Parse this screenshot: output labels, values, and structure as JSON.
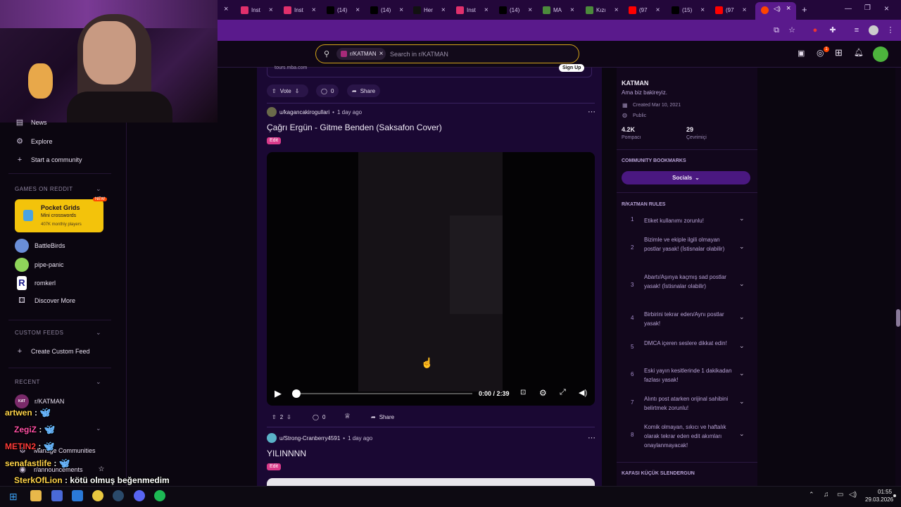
{
  "browser": {
    "tabs": [
      {
        "label": "Inst",
        "icon": "instagram-icon",
        "color": "#e1306c"
      },
      {
        "label": "Inst",
        "icon": "instagram-icon",
        "color": "#e1306c"
      },
      {
        "label": "(14)",
        "icon": "x-icon",
        "color": "#000000"
      },
      {
        "label": "(14)",
        "icon": "x-icon",
        "color": "#000000"
      },
      {
        "label": "Her",
        "icon": "tiktok-icon",
        "color": "#111111"
      },
      {
        "label": "Inst",
        "icon": "instagram-icon",
        "color": "#e1306c"
      },
      {
        "label": "(14)",
        "icon": "x-icon",
        "color": "#000000"
      },
      {
        "label": "MA",
        "icon": "map-icon",
        "color": "#4c8a3c"
      },
      {
        "label": "Kızı",
        "icon": "map-icon",
        "color": "#4c8a3c"
      },
      {
        "label": "(97",
        "icon": "youtube-icon",
        "color": "#ff0000"
      },
      {
        "label": "(15)",
        "icon": "x-icon",
        "color": "#000000"
      },
      {
        "label": "(97",
        "icon": "youtube-icon",
        "color": "#ff0000"
      }
    ],
    "new_tab": "+"
  },
  "header": {
    "subreddit_chip": "r/KATMAN",
    "search_placeholder": "Search in r/KATMAN",
    "notification_count": "1"
  },
  "sidebar": {
    "top_items": [
      {
        "label": "News",
        "icon": "news-icon"
      },
      {
        "label": "Explore",
        "icon": "explore-icon"
      },
      {
        "label": "Start a community",
        "icon": "plus-icon"
      }
    ],
    "games_header": "GAMES ON REDDIT",
    "pocket_grids": {
      "title": "Pocket Grids",
      "subtitle": "Mini crosswords",
      "users": "407K monthly players",
      "badge": "NEW"
    },
    "games": [
      {
        "label": "BattleBirds",
        "color": "#6a8ed8"
      },
      {
        "label": "pipe-panic",
        "color": "#8fd45a"
      },
      {
        "label": "romkerl",
        "color": "#ffffff"
      },
      {
        "label": "Discover More",
        "color": ""
      }
    ],
    "custom_header": "CUSTOM FEEDS",
    "create_feed": "Create Custom Feed",
    "recent_header": "RECENT",
    "recent_item": "r/KATMAN",
    "manage": "Manage Communities",
    "announcements": "r/announcements"
  },
  "feed": {
    "ad_domain": "tours.mba.com",
    "ad_signup": "Sign Up",
    "ad_actions": {
      "vote": "Vote",
      "comments": "0",
      "share": "Share"
    },
    "post1": {
      "author": "u/kagancakirogullari",
      "time": "1 day ago",
      "title": "Çağrı Ergün - Gitme Benden (Saksafon Cover)",
      "flair": "Edit",
      "video_time": "0:00 / 2:39",
      "votes": "2",
      "comments": "0",
      "share": "Share"
    },
    "post2": {
      "author": "u/Strong-Cranberry4591",
      "time": "1 day ago",
      "title": "YILINNNN",
      "flair": "Edit"
    }
  },
  "community": {
    "name": "KATMAN",
    "description": "Ama biz bakireyiz.",
    "created": "Created Mar 10, 2021",
    "visibility": "Public",
    "members": "4.2K",
    "members_label": "Pompacı",
    "online": "29",
    "online_label": "Çevrimiçi",
    "bookmarks_header": "COMMUNITY BOOKMARKS",
    "socials": "Socials",
    "rules_header": "R/KATMAN RULES",
    "rules": [
      {
        "num": "1",
        "text": "Etiket kullanımı zorunlu!"
      },
      {
        "num": "2",
        "text": "Bizimle ve ekiple ilgili olmayan postlar yasak! (İstisnalar olabilir)"
      },
      {
        "num": "3",
        "text": "Abartı/Aşınya kaçmış sad postlar yasak! (İstisnalar olabilir)"
      },
      {
        "num": "4",
        "text": "Birbirini tekrar eden/Aynı postlar yasak!"
      },
      {
        "num": "5",
        "text": "DMCA içeren seslere dikkat edin!"
      },
      {
        "num": "6",
        "text": "Eski yayın kesitlerinde 1 dakikadan fazlası yasak!"
      },
      {
        "num": "7",
        "text": "Alıntı post atarken orijinal sahibini belirtmek zorunlu!"
      },
      {
        "num": "8",
        "text": "Komik olmayan, sıkıcı ve haftalık olarak tekrar eden edit akımları onaylanmayacak!"
      }
    ],
    "next_header": "KAFASI KÜÇÜK SLENDERGUN"
  },
  "chat": [
    {
      "user": "artwen",
      "msg": "",
      "color": "#ffd24a"
    },
    {
      "user": "ZegiZ",
      "msg": "",
      "color": "#ff4fa8"
    },
    {
      "user": "METIN2",
      "msg": "",
      "color": "#ff3a3a"
    },
    {
      "user": "senafastlife",
      "msg": "",
      "color": "#ffd24a"
    },
    {
      "user": "SterkOfLion",
      "msg": "kötü olmuş beğenmedim",
      "color": "#ffd24a"
    }
  ],
  "taskbar": {
    "time": "01:55",
    "date": "29.03.2026"
  }
}
